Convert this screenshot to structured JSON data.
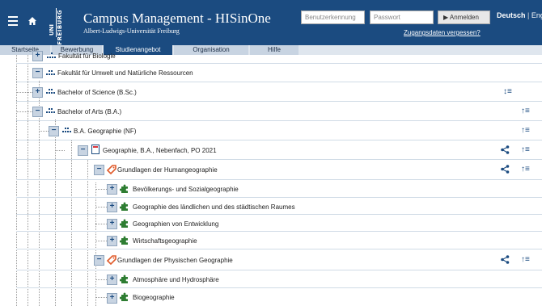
{
  "header": {
    "title": "Campus Management - HISinOne",
    "subtitle": "Albert-Ludwigs-Universität Freiburg",
    "logo_text_uni": "UNI",
    "logo_text_city": "FREIBURG",
    "username_placeholder": "Benutzerkennung",
    "password_placeholder": "Passwort",
    "login_label": "▶ Anmelden",
    "forgot_label": "Zugangsdaten vergessen?",
    "lang_active": "Deutsch",
    "lang_other": "Engli"
  },
  "tabs": [
    {
      "label": "Startseite",
      "active": false
    },
    {
      "label": "Bewerbung",
      "active": false
    },
    {
      "label": "Studienangebot",
      "active": true
    },
    {
      "label": "Organisation",
      "active": false
    },
    {
      "label": "Hilfe",
      "active": false
    }
  ],
  "tree": [
    {
      "label": "Fakultät für Biologie",
      "toggle": "+",
      "icon": "org-icon"
    },
    {
      "label": "Fakultät für Umwelt und Natürliche Ressourcen",
      "toggle": "−",
      "icon": "org-icon"
    },
    {
      "label": "Bachelor of Science (B.Sc.)",
      "toggle": "+",
      "icon": "org-icon",
      "sort": "↕≡"
    },
    {
      "label": "Bachelor of Arts (B.A.)",
      "toggle": "−",
      "icon": "org-icon",
      "sort": "↑≡"
    },
    {
      "label": "B.A. Geographie (NF)",
      "toggle": "−",
      "icon": "org-icon",
      "sort": "↑≡"
    },
    {
      "label": "Geographie, B.A., Nebenfach, PO 2021",
      "toggle": "−",
      "icon": "document-icon",
      "share": true,
      "sort": "↑≡"
    },
    {
      "label": "Grundlagen der Humangeographie",
      "toggle": "−",
      "icon": "tag-icon",
      "share": true,
      "sort": "↑≡"
    },
    {
      "label": "Bevölkerungs- und Sozialgeographie",
      "toggle": "+",
      "icon": "puzzle-icon"
    },
    {
      "label": "Geographie des ländlichen und des städtischen Raumes",
      "toggle": "+",
      "icon": "puzzle-icon"
    },
    {
      "label": "Geographien von Entwicklung",
      "toggle": "+",
      "icon": "puzzle-icon"
    },
    {
      "label": "Wirtschaftsgeographie",
      "toggle": "+",
      "icon": "puzzle-icon"
    },
    {
      "label": "Grundlagen der Physischen Geographie",
      "toggle": "−",
      "icon": "tag-icon",
      "share": true,
      "sort": "↑≡"
    },
    {
      "label": "Atmosphäre und Hydrosphäre",
      "toggle": "+",
      "icon": "puzzle-icon"
    },
    {
      "label": "Biogeographie",
      "toggle": "+",
      "icon": "puzzle-icon"
    }
  ],
  "colors": {
    "header": "#1b4b80",
    "tab_inactive": "#c8d4e2",
    "toggle_bg": "#c8d4e2",
    "org_icon": "#1b4b80",
    "puzzle_icon": "#2e7d32",
    "tag_icon": "#e05a2a"
  }
}
